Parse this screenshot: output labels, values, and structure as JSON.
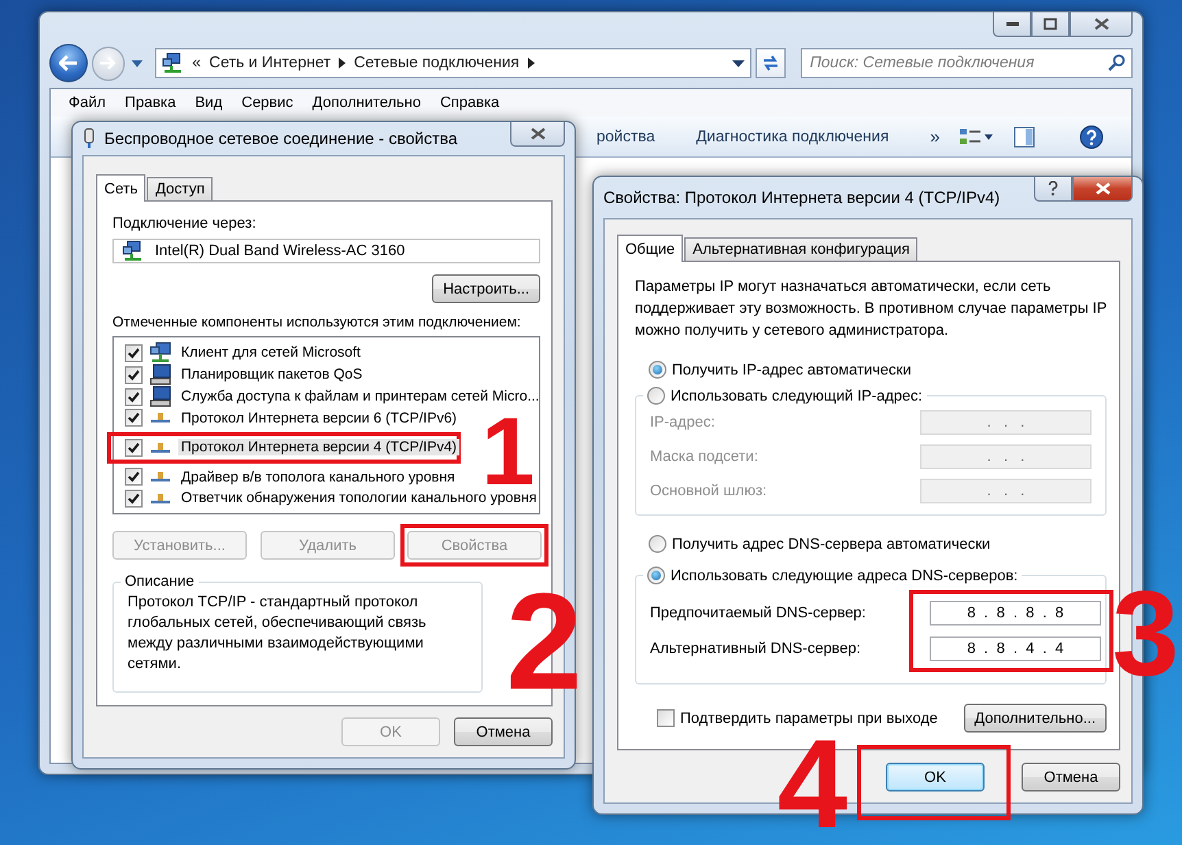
{
  "explorer": {
    "overflow_mark": "«",
    "breadcrumbs": [
      "Сеть и Интернет",
      "Сетевые подключения"
    ],
    "search": {
      "placeholder": "Поиск: Сетевые подключения"
    },
    "menu": [
      "Файл",
      "Правка",
      "Вид",
      "Сервис",
      "Дополнительно",
      "Справка"
    ],
    "toolbar": [
      "ройства",
      "Диагностика подключения"
    ],
    "toolbar_more": "»"
  },
  "wireless_dialog": {
    "title": "Беспроводное сетевое соединение - свойства",
    "tabs": [
      {
        "label": "Сеть",
        "selected": true
      },
      {
        "label": "Доступ",
        "selected": false
      }
    ],
    "connect_label": "Подключение через:",
    "adapter": "Intel(R) Dual Band Wireless-AC 3160",
    "configure_button": "Настроить...",
    "components_label": "Отмеченные компоненты используются этим подключением:",
    "components": [
      {
        "kind": "client",
        "label": "Клиент для сетей Microsoft",
        "checked": true,
        "selected": false
      },
      {
        "kind": "service",
        "label": "Планировщик пакетов QoS",
        "checked": true,
        "selected": false
      },
      {
        "kind": "service",
        "label": "Служба доступа к файлам и принтерам сетей Micro...",
        "checked": true,
        "selected": false
      },
      {
        "kind": "protocol",
        "label": "Протокол Интернета версии 6 (TCP/IPv6)",
        "checked": true,
        "selected": false
      },
      {
        "kind": "protocol",
        "label": "Протокол Интернета версии 4 (TCP/IPv4)",
        "checked": true,
        "selected": true,
        "annotation": "1"
      },
      {
        "kind": "protocol",
        "label": "Драйвер в/в тополога канального уровня",
        "checked": true,
        "selected": false
      },
      {
        "kind": "protocol",
        "label": "Ответчик обнаружения топологии канального уровня",
        "checked": true,
        "selected": false
      }
    ],
    "actions": [
      {
        "label": "Установить...",
        "disabled": true
      },
      {
        "label": "Удалить",
        "disabled": true
      },
      {
        "label": "Свойства",
        "disabled": true,
        "annotation": "2"
      }
    ],
    "description": {
      "title": "Описание",
      "text": "Протокол TCP/IP - стандартный протокол глобальных сетей, обеспечивающий связь между различными взаимодействующими сетями."
    },
    "buttons": [
      {
        "label": "OK",
        "disabled": true
      },
      {
        "label": "Отмена",
        "disabled": false
      }
    ]
  },
  "ipv4_dialog": {
    "title": "Свойства: Протокол Интернета версии 4 (TCP/IPv4)",
    "tabs": [
      {
        "label": "Общие",
        "selected": true
      },
      {
        "label": "Альтернативная конфигурация",
        "selected": false
      }
    ],
    "intro": "Параметры IP могут назначаться автоматически, если сеть поддерживает эту возможность. В противном случае параметры IP можно получить у сетевого администратора.",
    "ip_mode": [
      {
        "label": "Получить IP-адрес автоматически",
        "selected": true
      },
      {
        "label": "Использовать следующий IP-адрес:",
        "selected": false
      }
    ],
    "ip_fields_disabled": true,
    "ip_fields": [
      {
        "label": "IP-адрес:",
        "value": ".   .   ."
      },
      {
        "label": "Маска подсети:",
        "value": ".   .   ."
      },
      {
        "label": "Основной шлюз:",
        "value": ".   .   ."
      }
    ],
    "dns_mode": [
      {
        "label": "Получить адрес DNS-сервера автоматически",
        "selected": false
      },
      {
        "label": "Использовать следующие адреса DNS-серверов:",
        "selected": true
      }
    ],
    "dns_annotation": "3",
    "dns_fields": [
      {
        "label": "Предпочитаемый DNS-сервер:",
        "value": "8  .  8  .  8  .  8"
      },
      {
        "label": "Альтернативный DNS-сервер:",
        "value": "8  .  8  .  4  .  4"
      }
    ],
    "validate": {
      "label": "Подтвердить параметры при выходе",
      "checked": false
    },
    "advanced_button": "Дополнительно...",
    "buttons": [
      {
        "label": "OK",
        "default": true,
        "annotation": "4"
      },
      {
        "label": "Отмена",
        "default": false
      }
    ]
  }
}
